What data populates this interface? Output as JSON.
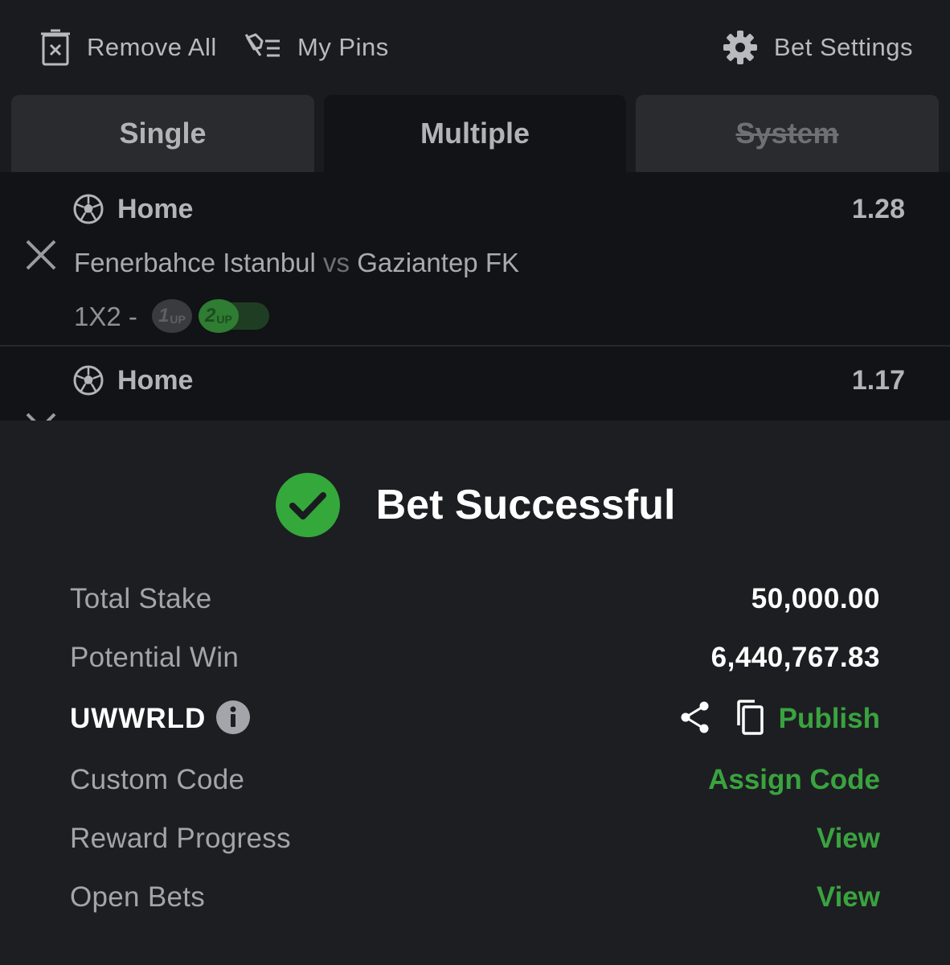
{
  "toolbar": {
    "remove_all": "Remove All",
    "my_pins": "My Pins",
    "bet_settings": "Bet Settings"
  },
  "tabs": [
    {
      "label": "Single",
      "state": "inactive"
    },
    {
      "label": "Multiple",
      "state": "active"
    },
    {
      "label": "System",
      "state": "disabled"
    }
  ],
  "selections": [
    {
      "pick": "Home",
      "odds": "1.28",
      "home_team": "Fenerbahce Istanbul",
      "vs": "vs",
      "away_team": "Gaziantep FK",
      "market": "1X2 -",
      "boosts": [
        {
          "num": "1",
          "sub": "UP"
        },
        {
          "num": "2",
          "sub": "UP"
        }
      ]
    },
    {
      "pick": "Home",
      "odds": "1.17"
    }
  ],
  "result": {
    "title": "Bet Successful",
    "total_stake_label": "Total Stake",
    "total_stake": "50,000.00",
    "potential_win_label": "Potential Win",
    "potential_win": "6,440,767.83",
    "booking_code": "UWWRLD",
    "publish": "Publish",
    "custom_code_label": "Custom Code",
    "assign_code": "Assign Code",
    "reward_progress_label": "Reward Progress",
    "reward_progress_action": "View",
    "open_bets_label": "Open Bets",
    "open_bets_action": "View"
  },
  "colors": {
    "background": "#1a1b1f",
    "accent_green": "#3aa33f",
    "success_green": "#34a83a",
    "text_primary": "#ffffff",
    "text_secondary": "#a4a5aa"
  },
  "icons": [
    "trash-icon",
    "pin-icon",
    "gear-icon",
    "close-icon",
    "soccer-ball-icon",
    "check-circle-icon",
    "info-icon",
    "share-icon",
    "copy-icon"
  ]
}
